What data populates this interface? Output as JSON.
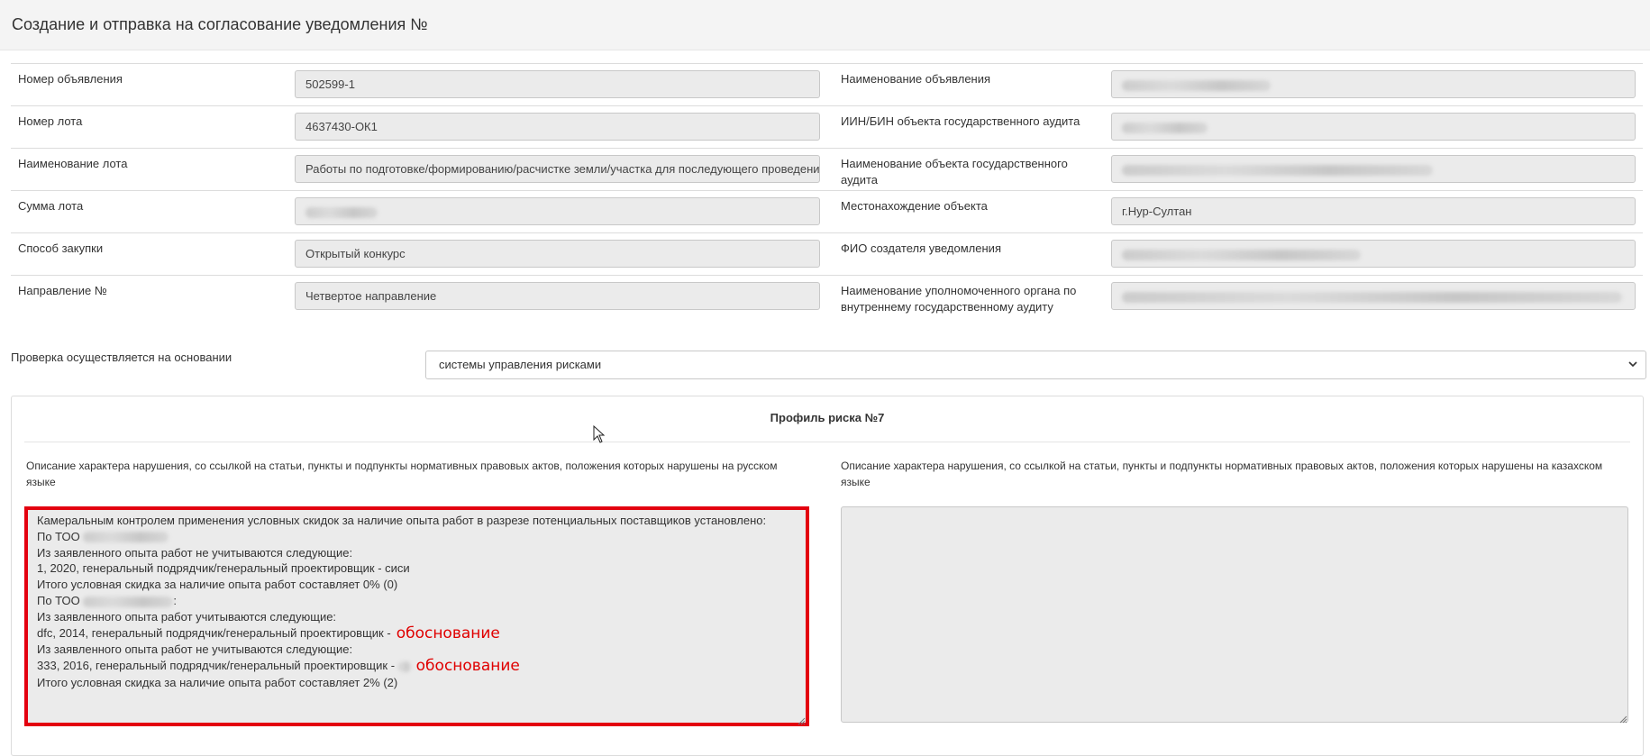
{
  "header": {
    "title": "Создание и отправка на согласование уведомления №"
  },
  "rows": [
    {
      "left_label": "Номер объявления",
      "left_value": "502599-1",
      "right_label": "Наименование объявления",
      "right_value": ""
    },
    {
      "left_label": "Номер лота",
      "left_value": "4637430-ОК1",
      "right_label": "ИИН/БИН объекта государственного аудита",
      "right_value": ""
    },
    {
      "left_label": "Наименование лота",
      "left_value": "Работы по подготовке/формированию/расчистке земли/участка для последующего проведения",
      "right_label": "Наименование объекта государственного аудита",
      "right_value": ""
    },
    {
      "left_label": "Сумма лота",
      "left_value": "",
      "right_label": "Местонахождение объекта",
      "right_value": "г.Нур-Султан"
    },
    {
      "left_label": "Способ закупки",
      "left_value": "Открытый конкурс",
      "right_label": "ФИО создателя уведомления",
      "right_value": ""
    },
    {
      "left_label": "Направление №",
      "left_value": "Четвертое направление",
      "right_label_line1": "Наименование уполномоченного органа по",
      "right_label_line2": "внутреннему государственному аудиту",
      "right_value": ""
    }
  ],
  "basis": {
    "label": "Проверка осуществляется на основании",
    "selected": "системы управления рисками"
  },
  "risk_panel": {
    "title": "Профиль риска №7",
    "desc_ru_line1": "Описание характера нарушения, со ссылкой на статьи, пункты и подпункты нормативных правовых актов, положения которых нарушены на русском",
    "desc_ru_line2": "языке",
    "desc_kz_line1": "Описание характера нарушения, со ссылкой на статьи, пункты и подпункты нормативных правовых актов, положения которых нарушены на казахском",
    "desc_kz_line2": "языке",
    "text_ru": {
      "l1": "Камеральным контролем применения условных скидок за наличие опыта работ в разрезе потенциальных поставщиков установлено:",
      "l2": "По ТОО",
      "l3": "Из заявленного опыта работ не учитываются следующие:",
      "l4": "1, 2020, генеральный подрядчик/генеральный проектировщик - сиси",
      "l5": "Итого условная скидка за наличие опыта работ  составляет 0% (0)",
      "l6": "По ТОО",
      "l6_tail": ":",
      "l7": "Из заявленного опыта работ учитываются следующие:",
      "l8": "dfc, 2014, генеральный подрядчик/генеральный проектировщик -",
      "l9": "Из заявленного опыта работ не учитываются следующие:",
      "l10": "333, 2016, генеральный подрядчик/генеральный проектировщик -",
      "l11": "Итого условная скидка за наличие опыта работ  составляет 2% (2)"
    },
    "annotation": "обоснование",
    "annotation_color": "#e00000"
  },
  "colors": {
    "highlight_border": "#e3000f",
    "field_bg": "#ebebeb"
  },
  "icons": [
    "chevron-down-icon",
    "mouse-cursor-icon",
    "resize-grip-icon"
  ]
}
